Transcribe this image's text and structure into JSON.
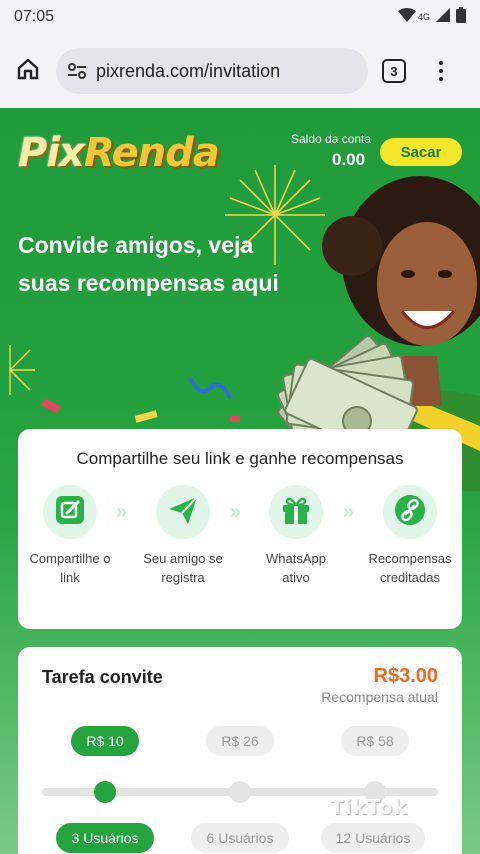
{
  "status_bar": {
    "time": "07:05",
    "network": "4G",
    "icons": [
      "wifi-icon",
      "signal-icon",
      "battery-icon"
    ]
  },
  "browser": {
    "url": "pixrenda.com/invitation",
    "tab_count": "3"
  },
  "header": {
    "logo_part1": "Pix",
    "logo_part2": "Renda",
    "balance_label": "Saldo da conta",
    "balance_value": "0.00",
    "withdraw_label": "Sacar"
  },
  "hero": {
    "headline_line1": "Convide amigos, veja",
    "headline_line2": "suas recompensas aqui"
  },
  "share_card": {
    "title": "Compartilhe seu link e ganhe recompensas",
    "steps": [
      {
        "line1": "Compartilhe o",
        "line2": "link",
        "icon": "edit-icon"
      },
      {
        "line1": "Seu amigo se",
        "line2": "registra",
        "icon": "paper-plane-icon"
      },
      {
        "line1": "WhatsApp",
        "line2": "ativo",
        "icon": "gift-icon"
      },
      {
        "line1": "Recompensas",
        "line2": "creditadas",
        "icon": "link-icon"
      }
    ]
  },
  "task_card": {
    "title": "Tarefa convite",
    "reward_value": "R$3.00",
    "reward_label": "Recompensa atual",
    "tiers": [
      {
        "reward": "R$ 10",
        "users": "3 Usuários",
        "active": true
      },
      {
        "reward": "R$ 26",
        "users": "6 Usuários",
        "active": false
      },
      {
        "reward": "R$ 58",
        "users": "12 Usuários",
        "active": false
      }
    ]
  },
  "watermark": "TikTok",
  "colors": {
    "brand_green": "#23a43e",
    "withdraw_yellow": "#f5e62a",
    "reward_orange": "#ef6a1e"
  }
}
